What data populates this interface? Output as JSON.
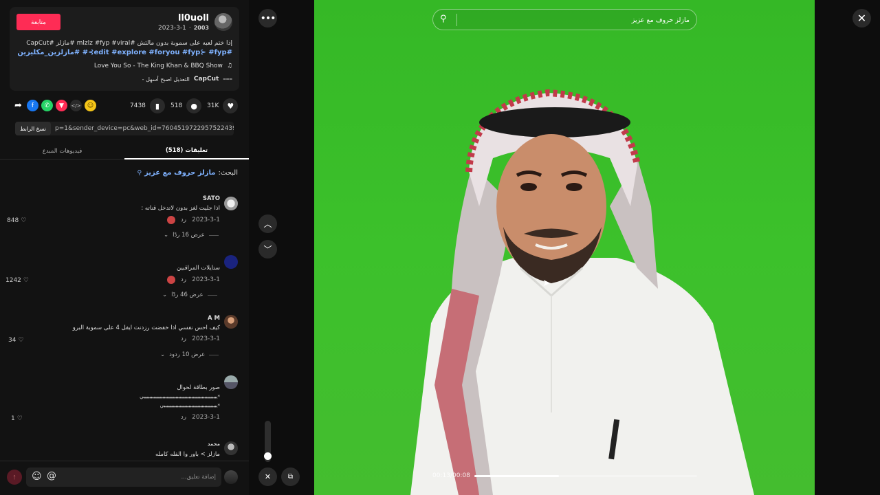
{
  "author": {
    "name": "ll0uoll",
    "handle_suffix": "2003",
    "date": "2023-3-1",
    "follow_label": "متابعة"
  },
  "caption": {
    "text": "إذا ختم لعبه على سموبة بدون مالتش #mlzlz #fyp #viral #مازلز #CapCut",
    "tags_line": "#edit #explore #foryou #fyp⊱ #fyp⊱# #مازلزين_مكليزين"
  },
  "music": {
    "title": "Love You So - The King Khan & BBQ Show",
    "icon": "music-note-icon"
  },
  "capcut": {
    "brand": "CapCut",
    "tagline": "- التعديل اصبح أسهل"
  },
  "stats": {
    "likes": "31K",
    "comments": "518",
    "saves": "7438"
  },
  "share": {
    "icons": [
      "share-arrow-icon",
      "facebook-icon",
      "whatsapp-icon",
      "telegram-icon",
      "embed-icon",
      "coin-icon"
    ]
  },
  "link": {
    "copy_label": "نسخ الرابط",
    "url": "p=1&sender_device=pc&web_id=7604519722957522439..."
  },
  "tabs": [
    {
      "label": "تعليقات (518)",
      "active": true
    },
    {
      "label": "فيديوهات المبدع",
      "active": false
    }
  ],
  "search_hint": {
    "prefix": "البحث:",
    "query": "مازلز حروف مع عزيز"
  },
  "comments": [
    {
      "user": "SATO",
      "text": "اذا جليت لغز بدون لاتدخل قناته :",
      "date": "2023-3-1",
      "reply": "رد",
      "likes": "848",
      "replies": "عرض 16 ردًا"
    },
    {
      "user": "",
      "text": "ستايلات المراقبين",
      "date": "2023-3-1",
      "reply": "رد",
      "likes": "1242",
      "replies": "عرض 46 ردًا"
    },
    {
      "user": "A M",
      "text": "كيف احس نفسي اذا خفضت رزدنت ايفل 4 على سموبة البرو",
      "date": "2023-3-1",
      "reply": "رد",
      "likes": "34",
      "replies": "عرض 10 ردود"
    },
    {
      "user": "",
      "text": "صور بطاقة لحوال",
      "text2": "*يييييييييييييييييييييييييييييييييييييييييييييييييييي",
      "text3": "*يييييييييييييييييييييييييييييييييييييي",
      "date": "2023-3-1",
      "reply": "رد",
      "likes": "1"
    },
    {
      "user": "محمد",
      "text": "مازلز > باور وا الفله كامله"
    }
  ],
  "composer": {
    "placeholder": "إضافة تعليق..."
  },
  "video": {
    "search_value": "مازلز حروف مع عزيز",
    "time": "00:13/00:08",
    "progress": 0.38
  },
  "colors": {
    "accent": "#fe2c55",
    "link": "#7fb2ff",
    "screen": "#3cc12b"
  }
}
